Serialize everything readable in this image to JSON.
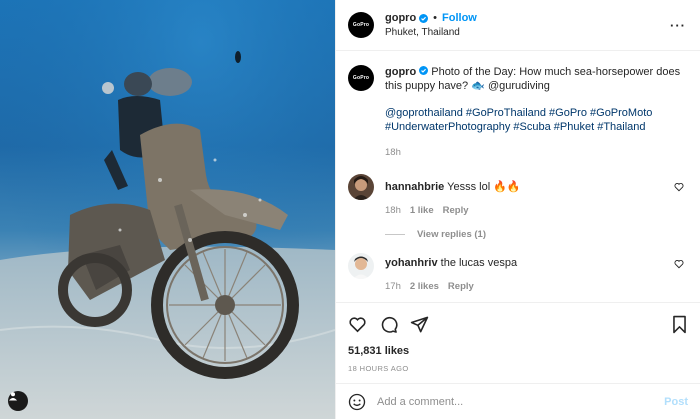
{
  "post": {
    "author": "gopro",
    "follow_label": "Follow",
    "dot": "•",
    "location": "Phuket, Thailand",
    "more_label": "···",
    "caption_text": "Photo of the Day: How much sea-horsepower does this puppy have? 🐟 @gurudiving",
    "caption_tags": "@goprothailand #GoProThailand #GoPro #GoProMoto #UnderwaterPhotography #Scuba #Phuket #Thailand",
    "caption_time": "18h",
    "avatar_text": "GoPro",
    "likes": "51,831 likes",
    "time_ago": "18 HOURS AGO"
  },
  "comments": [
    {
      "user": "hannahbrie",
      "text": "Yesss lol 🔥🔥",
      "time": "18h",
      "likes": "1 like",
      "reply_label": "Reply",
      "view_replies": "View replies (1)"
    },
    {
      "user": "yohanhriv",
      "text": "the lucas vespa",
      "time": "17h",
      "likes": "2 likes",
      "reply_label": "Reply"
    }
  ],
  "add_comment": {
    "placeholder": "Add a comment...",
    "post_label": "Post"
  },
  "colors": {
    "link": "#0095f6",
    "hashtag": "#00376b",
    "muted": "#8e8e8e",
    "post_disabled": "#b2dffc",
    "border": "#efefef"
  },
  "icons": [
    "heart-icon",
    "comment-icon",
    "share-icon",
    "bookmark-icon",
    "emoji-icon",
    "verified-badge-icon",
    "user-tag-icon",
    "more-icon"
  ]
}
